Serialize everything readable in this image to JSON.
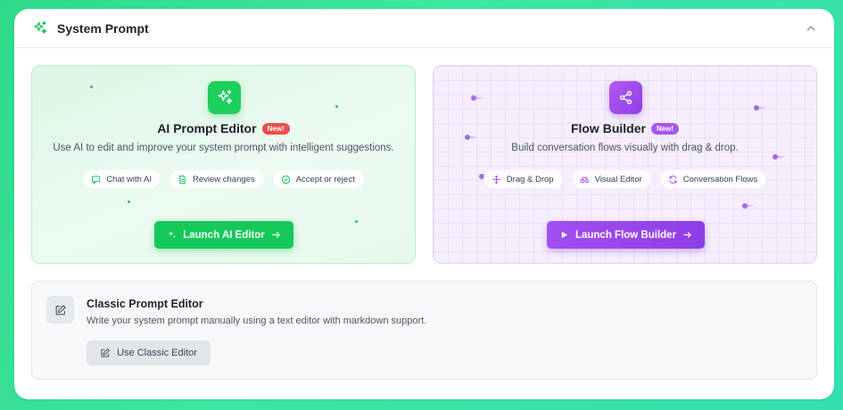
{
  "header": {
    "title": "System Prompt",
    "icon": "sparkles-icon",
    "collapse_icon": "chevron-up-icon"
  },
  "ai_card": {
    "title": "AI Prompt Editor",
    "badge": "New!",
    "description": "Use AI to edit and improve your system prompt with intelligent suggestions.",
    "chips": [
      {
        "label": "Chat with AI",
        "icon": "chat-icon"
      },
      {
        "label": "Review changes",
        "icon": "document-icon"
      },
      {
        "label": "Accept or reject",
        "icon": "check-circle-icon"
      }
    ],
    "button_label": "Launch AI Editor",
    "accent": "#14c95a"
  },
  "flow_card": {
    "title": "Flow Builder",
    "badge": "New!",
    "description": "Build conversation flows visually with drag & drop.",
    "chips": [
      {
        "label": "Drag & Drop",
        "icon": "drag-icon"
      },
      {
        "label": "Visual Editor",
        "icon": "nodes-icon"
      },
      {
        "label": "Conversation Flows",
        "icon": "refresh-icon"
      }
    ],
    "button_label": "Launch Flow Builder",
    "accent": "#9a47ec"
  },
  "classic": {
    "title": "Classic Prompt Editor",
    "description": "Write your system prompt manually using a text editor with markdown support.",
    "button_label": "Use Classic Editor",
    "icon": "edit-icon"
  }
}
